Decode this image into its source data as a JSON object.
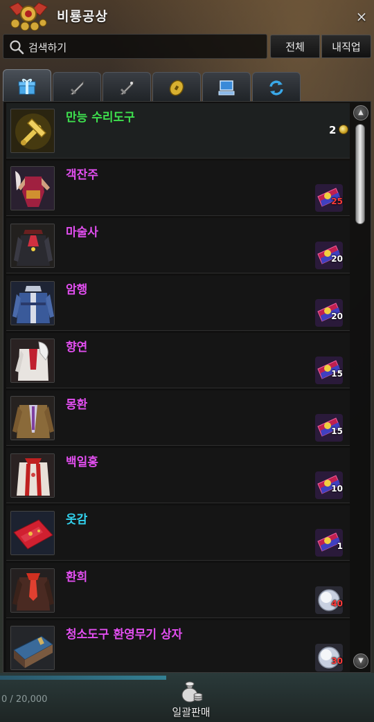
{
  "window": {
    "title": "비룡공상",
    "close_glyph": "×"
  },
  "search": {
    "placeholder": "검색하기"
  },
  "filters": {
    "all_label": "전체",
    "job_label": "내직업"
  },
  "tabs": [
    {
      "icon": "gift-icon",
      "active": true
    },
    {
      "icon": "sword-icon",
      "active": false
    },
    {
      "icon": "sword-icon",
      "active": false
    },
    {
      "icon": "coin-icon",
      "active": false
    },
    {
      "icon": "computer-icon",
      "active": false
    },
    {
      "icon": "refresh-icon",
      "active": false
    }
  ],
  "items": [
    {
      "name": "만능 수리도구",
      "color": "#3ee04e",
      "price": "2",
      "currency": "gold-coin-icon"
    },
    {
      "name": "객잔주",
      "color": "#e24ef0",
      "price": "25",
      "currency": "costume-ticket-icon"
    },
    {
      "name": "마술사",
      "color": "#e24ef0",
      "price": "20",
      "currency": "costume-ticket-icon"
    },
    {
      "name": "암행",
      "color": "#e24ef0",
      "price": "20",
      "currency": "costume-ticket-icon"
    },
    {
      "name": "향연",
      "color": "#e24ef0",
      "price": "15",
      "currency": "costume-ticket-icon"
    },
    {
      "name": "몽환",
      "color": "#e24ef0",
      "price": "15",
      "currency": "costume-ticket-icon"
    },
    {
      "name": "백일홍",
      "color": "#e24ef0",
      "price": "10",
      "currency": "costume-ticket-icon"
    },
    {
      "name": "옷감",
      "color": "#32d2ee",
      "price": "1",
      "currency": "costume-ticket-icon"
    },
    {
      "name": "환희",
      "color": "#e24ef0",
      "price": "40",
      "currency": "silver-orb-icon"
    },
    {
      "name": "청소도구 환영무기 상자",
      "color": "#e24ef0",
      "price": "30",
      "currency": "silver-orb-icon"
    }
  ],
  "footer": {
    "capacity": "0 / 20,000",
    "bulk_sell_label": "일괄판매"
  }
}
